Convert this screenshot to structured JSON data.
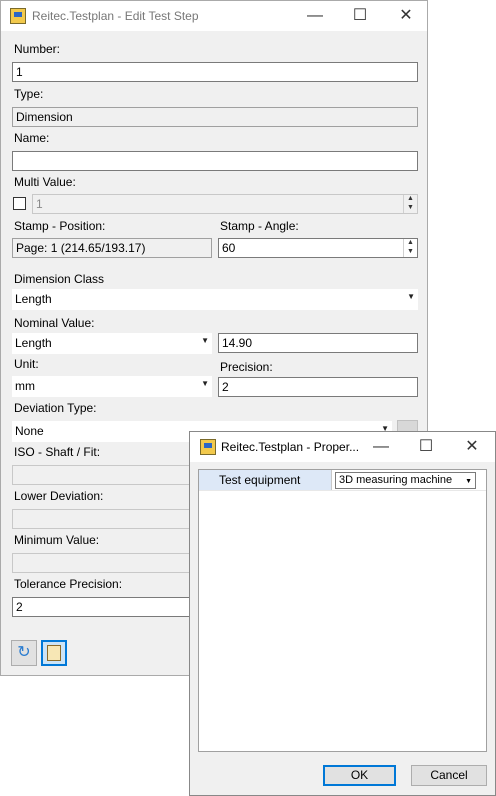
{
  "edit_dialog": {
    "title": "Reitec.Testplan - Edit Test Step",
    "number_label": "Number:",
    "number_value": "1",
    "type_label": "Type:",
    "type_value": "Dimension",
    "name_label": "Name:",
    "name_value": "",
    "multi_value_label": "Multi Value:",
    "multi_value_checked": false,
    "multi_value_value": "1",
    "stamp_position_label": "Stamp - Position:",
    "stamp_position_value": "Page: 1 (214.65/193.17)",
    "stamp_angle_label": "Stamp - Angle:",
    "stamp_angle_value": "60",
    "dimension_class_label": "Dimension Class",
    "dimension_class_value": "Length",
    "nominal_value_label": "Nominal Value:",
    "nominal_type_value": "Length",
    "nominal_value": "14.90",
    "unit_label": "Unit:",
    "unit_value": "mm",
    "precision_label": "Precision:",
    "precision_value": "2",
    "deviation_type_label": "Deviation Type:",
    "deviation_type_value": "None",
    "iso_label": "ISO - Shaft / Fit:",
    "lower_deviation_label": "Lower Deviation:",
    "minimum_value_label": "Minimum Value:",
    "tolerance_precision_label": "Tolerance Precision:",
    "tolerance_precision_value": "2"
  },
  "properties_dialog": {
    "title": "Reitec.Testplan - Proper...",
    "property_name": "Test equipment",
    "property_value": "3D measuring machine",
    "ok_label": "OK",
    "cancel_label": "Cancel"
  },
  "icons": {
    "minimize": "minimize-icon",
    "maximize": "maximize-icon",
    "close": "close-icon",
    "refresh": "refresh-icon",
    "properties": "properties-icon",
    "dropdown": "chevron-down-icon"
  },
  "colors": {
    "window_bg": "#f0f0f0",
    "accent": "#0078d7",
    "selection": "#dde8f7"
  }
}
